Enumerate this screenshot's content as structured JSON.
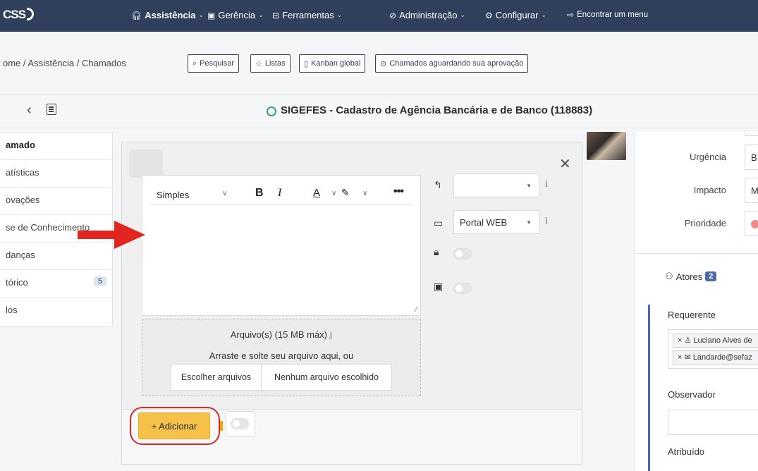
{
  "app": {
    "logo_text": "CSS"
  },
  "nav": {
    "items": [
      {
        "label": "Assistência",
        "icon": "headset-icon"
      },
      {
        "label": "Gerência",
        "icon": "clipboard-icon"
      },
      {
        "label": "Ferramentas",
        "icon": "briefcase-icon"
      },
      {
        "label": "Administração",
        "icon": "shield-check-icon"
      },
      {
        "label": "Configurar",
        "icon": "gear-icon"
      }
    ],
    "find_menu": "Encontrar um menu",
    "chevron": "⌄"
  },
  "breadcrumb": {
    "text": "ome / Assistência / Chamados"
  },
  "actions": {
    "search": "Pesquisar",
    "lists": "Listas",
    "kanban": "Kanban global",
    "awaiting": "Chamados aguardando sua aprovação"
  },
  "ticket": {
    "title": "SIGEFES - Cadastro de Agência Bancária e de Banco (118883)"
  },
  "left_menu": {
    "items": [
      {
        "label": "amado",
        "active": true
      },
      {
        "label": "atísticas"
      },
      {
        "label": "ovações"
      },
      {
        "label": "se de Conhecimento"
      },
      {
        "label": "danças"
      },
      {
        "label": "tórico",
        "badge": "5"
      },
      {
        "label": "los"
      }
    ]
  },
  "editor": {
    "style_select": "Simples",
    "bold": "B",
    "italic": "I",
    "font_color": "A",
    "more": "•••"
  },
  "followup": {
    "source_value": "Portal WEB",
    "info": "i"
  },
  "upload": {
    "title": "Arquivo(s) (15 MB máx)",
    "info": "i",
    "drag_text": "Arraste e solte seu arquivo aqui, ou",
    "choose_button": "Escolher arquivos",
    "no_file": "Nenhum arquivo escolhido"
  },
  "add_button": "+ Adicionar",
  "right_panel": {
    "urgency_label": "Urgência",
    "urgency_value": "B",
    "impact_label": "Impacto",
    "impact_value": "M",
    "priority_label": "Prioridade",
    "actors_label": "Atores",
    "actors_count": "2",
    "requester_label": "Requerente",
    "requester_user": "Luciano Alves de",
    "requester_email": "Landarde@sefaz",
    "observer_label": "Observador",
    "assigned_label": "Atribuído"
  },
  "colors": {
    "topbar": "#2f3f5c",
    "accent": "#f6c24a",
    "highlight_red": "#d62828",
    "status_green": "#38a169"
  }
}
